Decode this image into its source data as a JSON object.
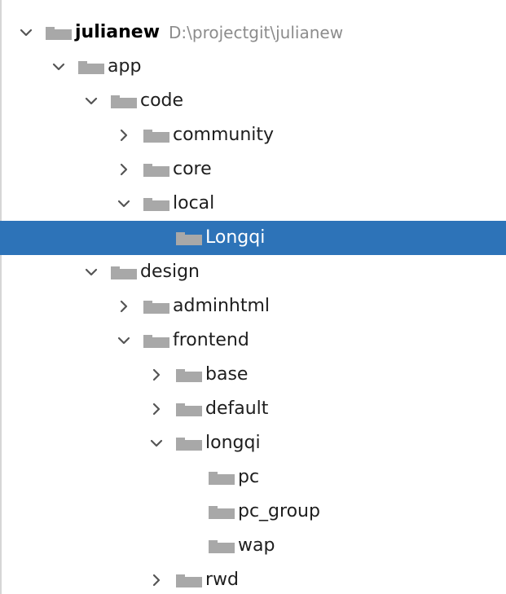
{
  "colors": {
    "selection": "#2d73b8",
    "folder": "#a8a8a8",
    "text": "#1e1e1e",
    "path_text": "#8c8c8c",
    "chevron": "#555555"
  },
  "icons": {
    "expanded": "chevron-down-icon",
    "collapsed": "chevron-right-icon",
    "folder": "folder-icon"
  },
  "tree": {
    "root": {
      "label": "julianew",
      "path": "D:\\projectgit\\julianew",
      "expanded": true
    },
    "nodes": [
      {
        "id": "app",
        "label": "app",
        "depth": 1,
        "state": "expanded"
      },
      {
        "id": "code",
        "label": "code",
        "depth": 2,
        "state": "expanded"
      },
      {
        "id": "community",
        "label": "community",
        "depth": 3,
        "state": "collapsed"
      },
      {
        "id": "core",
        "label": "core",
        "depth": 3,
        "state": "collapsed"
      },
      {
        "id": "local",
        "label": "local",
        "depth": 3,
        "state": "expanded"
      },
      {
        "id": "longqi-local",
        "label": "Longqi",
        "depth": 4,
        "state": "leaf",
        "selected": true
      },
      {
        "id": "design",
        "label": "design",
        "depth": 2,
        "state": "expanded"
      },
      {
        "id": "adminhtml",
        "label": "adminhtml",
        "depth": 3,
        "state": "collapsed"
      },
      {
        "id": "frontend",
        "label": "frontend",
        "depth": 3,
        "state": "expanded"
      },
      {
        "id": "base",
        "label": "base",
        "depth": 4,
        "state": "collapsed"
      },
      {
        "id": "default",
        "label": "default",
        "depth": 4,
        "state": "collapsed"
      },
      {
        "id": "longqi-theme",
        "label": "longqi",
        "depth": 4,
        "state": "expanded"
      },
      {
        "id": "pc",
        "label": "pc",
        "depth": 5,
        "state": "leaf"
      },
      {
        "id": "pc_group",
        "label": "pc_group",
        "depth": 5,
        "state": "leaf"
      },
      {
        "id": "wap",
        "label": "wap",
        "depth": 5,
        "state": "leaf"
      },
      {
        "id": "rwd",
        "label": "rwd",
        "depth": 4,
        "state": "collapsed"
      }
    ]
  }
}
